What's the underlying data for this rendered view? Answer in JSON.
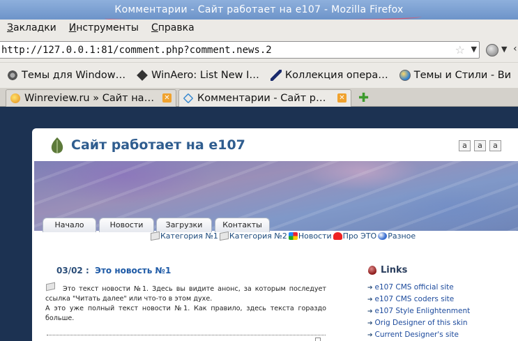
{
  "window": {
    "title": "Комментарии - Сайт работает на e107 - Mozilla Firefox"
  },
  "menubar": {
    "items": [
      {
        "label": "Закладки",
        "accel": "З",
        "rest": "акладки"
      },
      {
        "label": "Инструменты",
        "accel": "И",
        "rest": "нструменты"
      },
      {
        "label": "Справка",
        "accel": "С",
        "rest": "правка"
      }
    ]
  },
  "navbar": {
    "url": "http://127.0.0.1:81/comment.php?comment.news.2"
  },
  "bookmarks": {
    "items": [
      {
        "label": "Темы для Window…",
        "icon": "gear-icon"
      },
      {
        "label": "WinAero: List New I…",
        "icon": "cube-icon"
      },
      {
        "label": "Коллекция опера…",
        "icon": "pen-icon"
      },
      {
        "label": "Темы и Стили - Ви",
        "icon": "globe-icon"
      }
    ]
  },
  "tabs": [
    {
      "label": "Winreview.ru » Сайт на…",
      "active": false
    },
    {
      "label": "Комментарии - Сайт р…",
      "active": true
    }
  ],
  "site": {
    "title": "Сайт работает на e107",
    "font_size_buttons": [
      "a",
      "a",
      "a"
    ],
    "nav": [
      "Начало",
      "Новости",
      "Загрузки",
      "Контакты"
    ],
    "categories": [
      {
        "label": "Категория №1",
        "icon": "paper-icon"
      },
      {
        "label": "Категория №2",
        "icon": "paper-icon"
      },
      {
        "label": "Новости",
        "icon": "news-icon"
      },
      {
        "label": "Про ЭТО",
        "icon": "heart-icon"
      },
      {
        "label": "Разное",
        "icon": "ball-icon"
      }
    ],
    "news": {
      "date": "03/02",
      "separator": ":",
      "title": "Это новость №1",
      "body_1": "Это текст новости №1. Здесь вы видите анонс, за которым последует ссылка \"Читать далее\" или что-то в этом духе.",
      "body_2": "А это уже полный текст новости №1. Как правило, здесь текста гораздо больше."
    },
    "links": {
      "heading": "Links",
      "items": [
        "e107 CMS official site",
        "e107 CMS coders site",
        "e107 Style Enlightenment",
        "Orig Designer of this skin",
        "Current Designer's site"
      ]
    }
  },
  "colors": {
    "titlebar": "#7aa0d4",
    "desktop": "#1c3252",
    "site_title": "#2f5d8f",
    "link": "#1c4a9c"
  }
}
